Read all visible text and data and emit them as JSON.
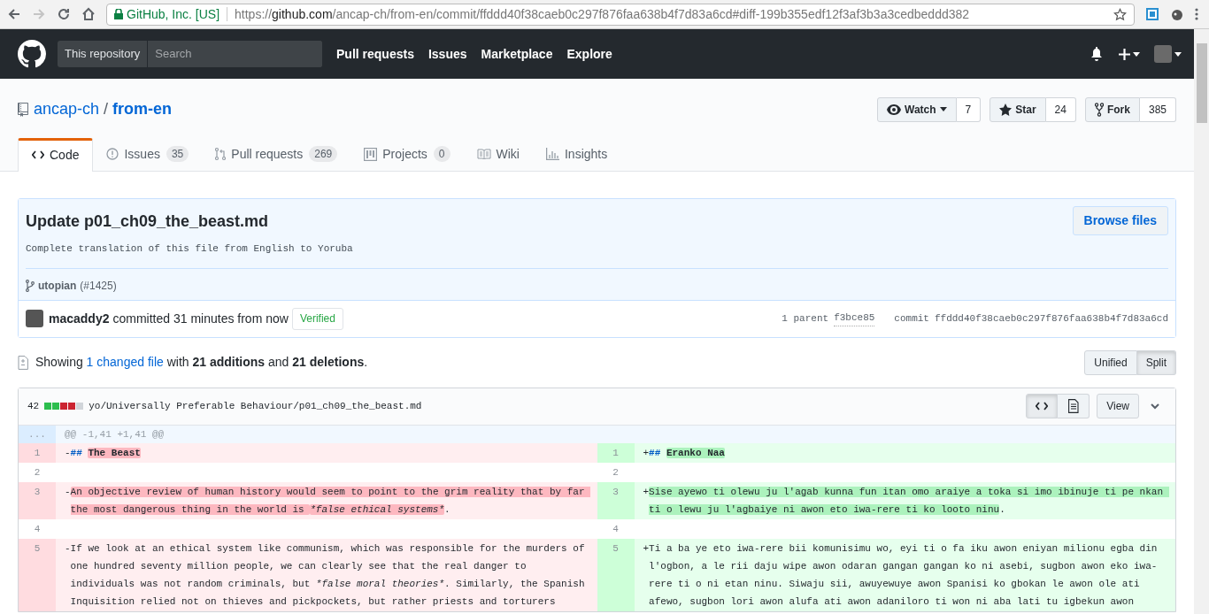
{
  "browser": {
    "secure_label": "GitHub, Inc. [US]",
    "url": {
      "scheme": "https://",
      "host": "github.com",
      "path": "/ancap-ch/from-en/commit/ffddd40f38caeb0c297f876faa638b4f7d83a6cd#diff-199b355edf12f3af3b3a3cedbeddd382"
    },
    "forward_disabled": true
  },
  "header": {
    "scope": "This repository",
    "search": {
      "placeholder": "Search"
    },
    "nav": [
      "Pull requests",
      "Issues",
      "Marketplace",
      "Explore"
    ]
  },
  "repo": {
    "owner": "ancap-ch",
    "separator": "/",
    "name": "from-en",
    "actions": [
      {
        "kind": "watch",
        "label": "Watch",
        "count": "7"
      },
      {
        "kind": "star",
        "label": "Star",
        "count": "24"
      },
      {
        "kind": "fork",
        "label": "Fork",
        "count": "385"
      }
    ],
    "tabs": [
      {
        "kind": "code",
        "label": "Code",
        "selected": true
      },
      {
        "kind": "issues",
        "label": "Issues",
        "counter": "35",
        "selected": false
      },
      {
        "kind": "pulls",
        "label": "Pull requests",
        "counter": "269",
        "selected": false
      },
      {
        "kind": "projects",
        "label": "Projects",
        "counter": "0",
        "selected": false
      },
      {
        "kind": "wiki",
        "label": "Wiki",
        "selected": false
      },
      {
        "kind": "insights",
        "label": "Insights",
        "selected": false
      }
    ]
  },
  "commit": {
    "title": "Update p01_ch09_the_beast.md",
    "description": "Complete translation of this file from English to Yoruba",
    "browse_button": "Browse files",
    "branch": "utopian",
    "pr_ref": "(#1425)",
    "author": "macaddy2",
    "committed_text": "committed 31 minutes from now",
    "verified": "Verified",
    "parent_label": "1 parent",
    "parent_sha": "f3bce85",
    "commit_label": "commit",
    "sha": "ffddd40f38caeb0c297f876faa638b4f7d83a6cd"
  },
  "summary": {
    "prefix": "Showing",
    "changed_files": "1 changed file",
    "text": "with **21 additions** and **21 deletions**."
  },
  "view_modes": [
    {
      "label": "Unified",
      "selected": false
    },
    {
      "label": "Split",
      "selected": true
    }
  ],
  "file": {
    "count": "42",
    "diffstat": [
      {
        "color": "#2cbe4e"
      },
      {
        "color": "#2cbe4e"
      },
      {
        "color": "#cb2431"
      },
      {
        "color": "#cb2431"
      },
      {
        "color": "#d1d5da"
      }
    ],
    "path": "yo/Universally Preferable Behaviour/p01_ch09_the_beast.md",
    "display_modes": [
      {
        "kind": "source",
        "selected": true
      },
      {
        "kind": "rich",
        "selected": false
      }
    ],
    "view_button": "View",
    "hunk": "@@ -1,41 +1,41 @@",
    "hunk_expander": "...",
    "rows": [
      {
        "left": {
          "num": "1",
          "kind": "deletion",
          "sign": "-",
          "segments": [
            {
              "text": "## ",
              "kind": "marker",
              "changed": false
            },
            {
              "text": "The Beast",
              "kind": "heading",
              "changed": true
            }
          ]
        },
        "right": {
          "num": "1",
          "kind": "addition",
          "sign": "+",
          "segments": [
            {
              "text": "## ",
              "kind": "marker",
              "changed": false
            },
            {
              "text": "Eranko Naa",
              "kind": "heading",
              "changed": true
            }
          ]
        }
      },
      {
        "left": {
          "num": "2",
          "kind": "context"
        },
        "right": {
          "num": "2",
          "kind": "context"
        }
      },
      {
        "left": {
          "num": "3",
          "kind": "deletion",
          "sign": "-",
          "segments": [
            {
              "text": "An objective review of human history would seem to point to the grim reality that by far the most dangerous thing in the world is ",
              "changed": true
            },
            {
              "text": "*false ethical systems*",
              "kind": "emphasis",
              "changed": true
            },
            {
              "text": ".",
              "changed": false
            }
          ]
        },
        "right": {
          "num": "3",
          "kind": "addition",
          "sign": "+",
          "segments": [
            {
              "text": "Sise ayewo ti olewu ju l'agab kunna fun itan omo araiye a toka si imo ibinuje ti pe nkan ti o lewu ju l'agbaiye ni awon eto iwa-rere ti ko looto ninu",
              "changed": true
            },
            {
              "text": ".",
              "changed": false
            }
          ]
        }
      },
      {
        "left": {
          "num": "4",
          "kind": "context"
        },
        "right": {
          "num": "4",
          "kind": "context"
        }
      },
      {
        "left": {
          "num": "5",
          "kind": "deletion",
          "sign": "-",
          "segments": [
            {
              "text": "If we look at an ethical system like communism, which was responsible for the murders of one hundred seventy million people, we can clearly see that the real danger to individuals was not random criminals, but "
            },
            {
              "text": "*false moral theories*",
              "kind": "emphasis"
            },
            {
              "text": ". Similarly, the Spanish Inquisition relied not on thieves and pickpockets, but rather priests and torturers"
            }
          ]
        },
        "right": {
          "num": "5",
          "kind": "addition",
          "sign": "+",
          "segments": [
            {
              "text": "Ti a ba ye eto iwa-rere bii komunisimu wo, eyi ti o fa iku awon eniyan milionu egba din l'ogbon, a le rii daju wipe awon odaran gangan gangan ko ni asebi, sugbon awon eko iwa-rere ti o ni etan ninu. Siwaju sii, awuyewuye awon Spanisi ko gbokan le awon ole ati afewo, sugbon lori awon alufa ati awon adaniloro ti won ni aba lati tu igbekun awon"
            }
          ]
        }
      }
    ]
  }
}
